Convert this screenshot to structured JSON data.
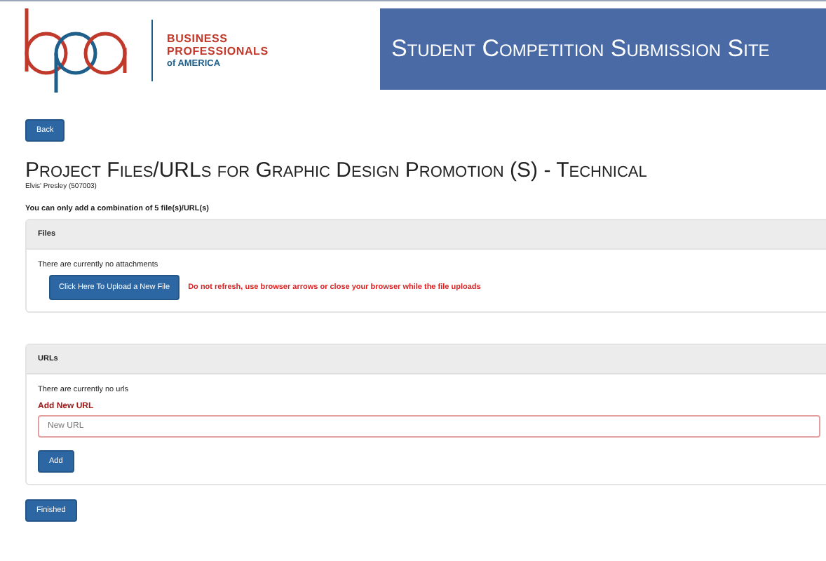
{
  "header": {
    "org_lines": [
      {
        "text": "BUSINESS",
        "kind": "main"
      },
      {
        "text": "PROFESSIONALS",
        "kind": "main"
      },
      {
        "text": "of AMERICA",
        "kind": "sub"
      }
    ],
    "site_title": "Student Competition Submission Site"
  },
  "back_button": "Back",
  "page_title": "Project Files/URLs for Graphic Design Promotion (S) - Technical",
  "student": "Elvis' Presley (507003)",
  "notice": "You can only add a combination of 5 file(s)/URL(s)",
  "files_panel": {
    "heading": "Files",
    "empty_text": "There are currently no attachments",
    "upload_button": "Click Here To Upload a New File",
    "warning": "Do not refresh, use browser arrows or close your browser while the file uploads"
  },
  "urls_panel": {
    "heading": "URLs",
    "empty_text": "There are currently no urls",
    "field_label": "Add New URL",
    "placeholder": "New URL",
    "add_button": "Add"
  },
  "finish_button": "Finished"
}
